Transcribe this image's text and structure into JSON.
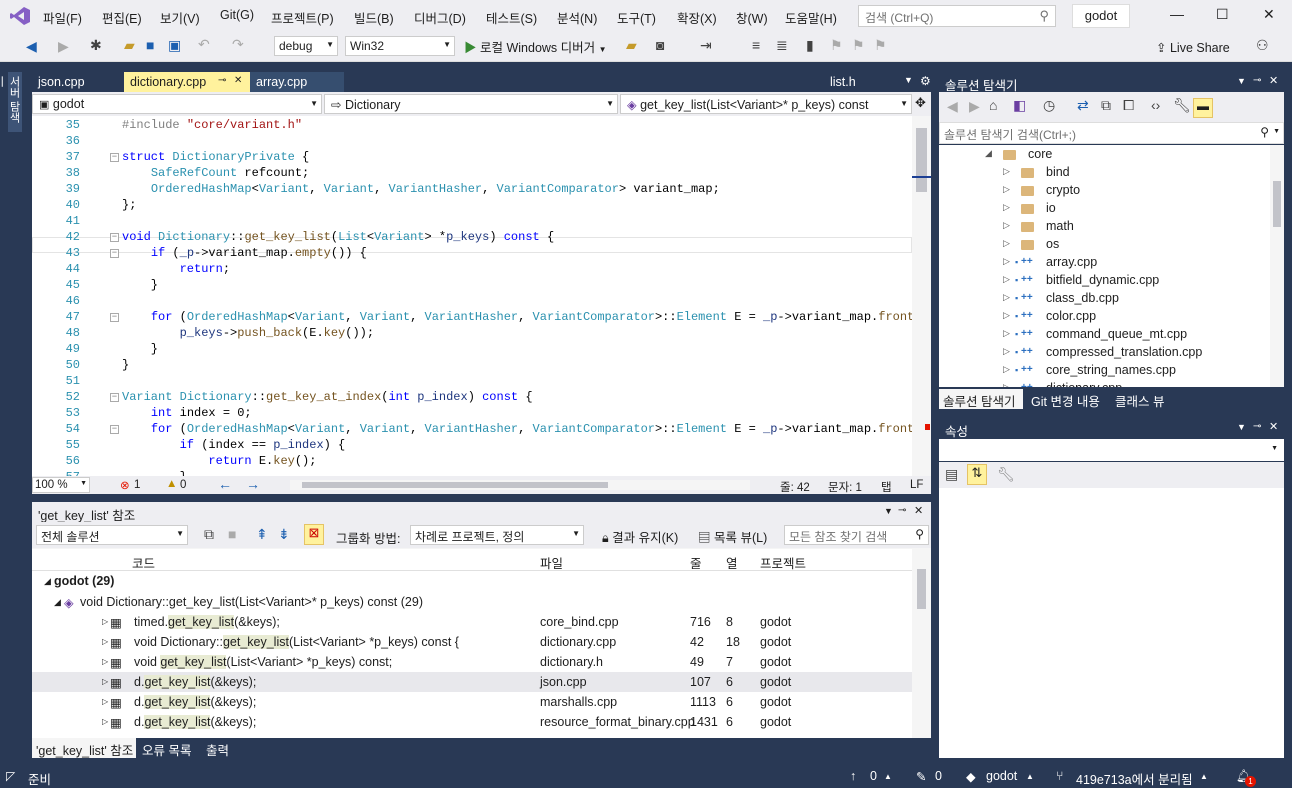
{
  "titlebar": {
    "menus": [
      "파일(F)",
      "편집(E)",
      "보기(V)",
      "Git(G)",
      "프로젝트(P)",
      "빌드(B)",
      "디버그(D)",
      "테스트(S)",
      "분석(N)",
      "도구(T)",
      "확장(X)",
      "창(W)",
      "도움말(H)"
    ],
    "search_placeholder": "검색 (Ctrl+Q)",
    "solution_name": "godot",
    "minimize": "—",
    "maximize": "☐",
    "close": "✕"
  },
  "toolbar": {
    "config": "debug",
    "platform": "Win32",
    "run_label": "로컬 Windows 디버거",
    "live_share": "Live Share"
  },
  "left_strip": {
    "label": "서버 탐색기"
  },
  "editor": {
    "tabs": [
      "json.cpp",
      "dictionary.cpp",
      "array.cpp"
    ],
    "active_tab_pin": "⊸",
    "active_tab_close": "✕",
    "right_tab": "list.h",
    "nav_project": "godot",
    "nav_class": "Dictionary",
    "nav_member": "get_key_list(List<Variant>* p_keys) const",
    "zoom": "100 %",
    "errors": "1",
    "warnings": "0",
    "line_label": "줄: 42",
    "char_label": "문자: 1",
    "tab_label": "탭",
    "eol_label": "LF"
  },
  "code_lines": [
    {
      "n": "35",
      "html": "<span class='pp'>#include</span> <span class='str'>\"core/variant.h\"</span>"
    },
    {
      "n": "36",
      "html": ""
    },
    {
      "n": "37",
      "html": "<span class='kw'>struct</span> <span class='ty'>DictionaryPrivate</span> {"
    },
    {
      "n": "38",
      "html": "    <span class='ty'>SafeRefCount</span> refcount;"
    },
    {
      "n": "39",
      "html": "    <span class='ty'>OrderedHashMap</span>&lt;<span class='ty'>Variant</span>, <span class='ty'>Variant</span>, <span class='ty'>VariantHasher</span>, <span class='ty'>VariantComparator</span>&gt; variant_map;"
    },
    {
      "n": "40",
      "html": "};"
    },
    {
      "n": "41",
      "html": ""
    },
    {
      "n": "42",
      "html": "<span class='kw'>void</span> <span class='ty'>Dictionary</span>::<span class='fn'>get_key_list</span>(<span class='ty'>List</span>&lt;<span class='ty'>Variant</span>&gt; *<span class='mem'>p_keys</span>) <span class='kw'>const</span> {"
    },
    {
      "n": "43",
      "html": "    <span class='kw'>if</span> (<span class='mem'>_p</span>-&gt;variant_map.<span class='fn'>empty</span>()) {"
    },
    {
      "n": "44",
      "html": "        <span class='kw'>return</span>;"
    },
    {
      "n": "45",
      "html": "    }"
    },
    {
      "n": "46",
      "html": ""
    },
    {
      "n": "47",
      "html": "    <span class='kw'>for</span> (<span class='ty'>OrderedHashMap</span>&lt;<span class='ty'>Variant</span>, <span class='ty'>Variant</span>, <span class='ty'>VariantHasher</span>, <span class='ty'>VariantComparator</span>&gt;::<span class='ty'>Element</span> E = <span class='mem'>_p</span>-&gt;variant_map.<span class='fn'>front</span>();"
    },
    {
      "n": "48",
      "html": "        <span class='mem'>p_keys</span>-&gt;<span class='fn'>push_back</span>(E.<span class='fn'>key</span>());"
    },
    {
      "n": "49",
      "html": "    }"
    },
    {
      "n": "50",
      "html": "}"
    },
    {
      "n": "51",
      "html": ""
    },
    {
      "n": "52",
      "html": "<span class='ty'>Variant</span> <span class='ty'>Dictionary</span>::<span class='fn'>get_key_at_index</span>(<span class='kw'>int</span> <span class='mem'>p_index</span>) <span class='kw'>const</span> {"
    },
    {
      "n": "53",
      "html": "    <span class='kw'>int</span> index = 0;"
    },
    {
      "n": "54",
      "html": "    <span class='kw'>for</span> (<span class='ty'>OrderedHashMap</span>&lt;<span class='ty'>Variant</span>, <span class='ty'>Variant</span>, <span class='ty'>VariantHasher</span>, <span class='ty'>VariantComparator</span>&gt;::<span class='ty'>Element</span> E = <span class='mem'>_p</span>-&gt;variant_map.<span class='fn'>front</span>();"
    },
    {
      "n": "55",
      "html": "        <span class='kw'>if</span> (index == <span class='mem'>p_index</span>) {"
    },
    {
      "n": "56",
      "html": "            <span class='kw'>return</span> E.<span class='fn'>key</span>();"
    },
    {
      "n": "57",
      "html": "        }"
    }
  ],
  "references": {
    "title": "'get_key_list' 참조",
    "scope": "전체 솔루션",
    "group_label": "그룹화 방법:",
    "group_value": "차례로 프로젝트, 정의",
    "keep_results": "결과 유지(K)",
    "list_view": "목록 뷰(L)",
    "search_placeholder": "모든 참조 찾기 검색",
    "columns": [
      "코드",
      "파일",
      "줄",
      "열",
      "프로젝트"
    ],
    "group_root": "godot (29)",
    "group_def": "void Dictionary::get_key_list(List<Variant>* p_keys) const (29)",
    "rows": [
      {
        "pre": "timed.",
        "hit": "get_key_list",
        "post": "(&keys);",
        "file": "core_bind.cpp",
        "line": "716",
        "col": "8",
        "project": "godot"
      },
      {
        "pre": "void Dictionary::",
        "hit": "get_key_list",
        "post": "(List<Variant> *p_keys) const {",
        "file": "dictionary.cpp",
        "line": "42",
        "col": "18",
        "project": "godot"
      },
      {
        "pre": "void ",
        "hit": "get_key_list",
        "post": "(List<Variant> *p_keys) const;",
        "file": "dictionary.h",
        "line": "49",
        "col": "7",
        "project": "godot"
      },
      {
        "pre": "d.",
        "hit": "get_key_list",
        "post": "(&keys);",
        "file": "json.cpp",
        "line": "107",
        "col": "6",
        "project": "godot"
      },
      {
        "pre": "d.",
        "hit": "get_key_list",
        "post": "(&keys);",
        "file": "marshalls.cpp",
        "line": "1113",
        "col": "6",
        "project": "godot"
      },
      {
        "pre": "d.",
        "hit": "get_key_list",
        "post": "(&keys);",
        "file": "resource_format_binary.cpp",
        "line": "1431",
        "col": "6",
        "project": "godot"
      }
    ]
  },
  "bottom_tabs": [
    "'get_key_list' 참조",
    "오류 목록",
    "출력"
  ],
  "solution_explorer": {
    "title": "솔루션 탐색기",
    "search_placeholder": "솔루션 탐색기 검색(Ctrl+;)",
    "root_folder": "core",
    "folders": [
      "bind",
      "crypto",
      "io",
      "math",
      "os"
    ],
    "files": [
      "array.cpp",
      "bitfield_dynamic.cpp",
      "class_db.cpp",
      "color.cpp",
      "command_queue_mt.cpp",
      "compressed_translation.cpp",
      "core_string_names.cpp",
      "dictionary.cpp"
    ],
    "tabs": [
      "솔루션 탐색기",
      "Git 변경 내용",
      "클래스 뷰"
    ]
  },
  "properties": {
    "title": "속성"
  },
  "statusbar": {
    "ready": "준비",
    "up_count": "0",
    "edit_count": "0",
    "branch_repo": "godot",
    "branch": "419e713a에서 분리됨",
    "notifications": "1"
  }
}
